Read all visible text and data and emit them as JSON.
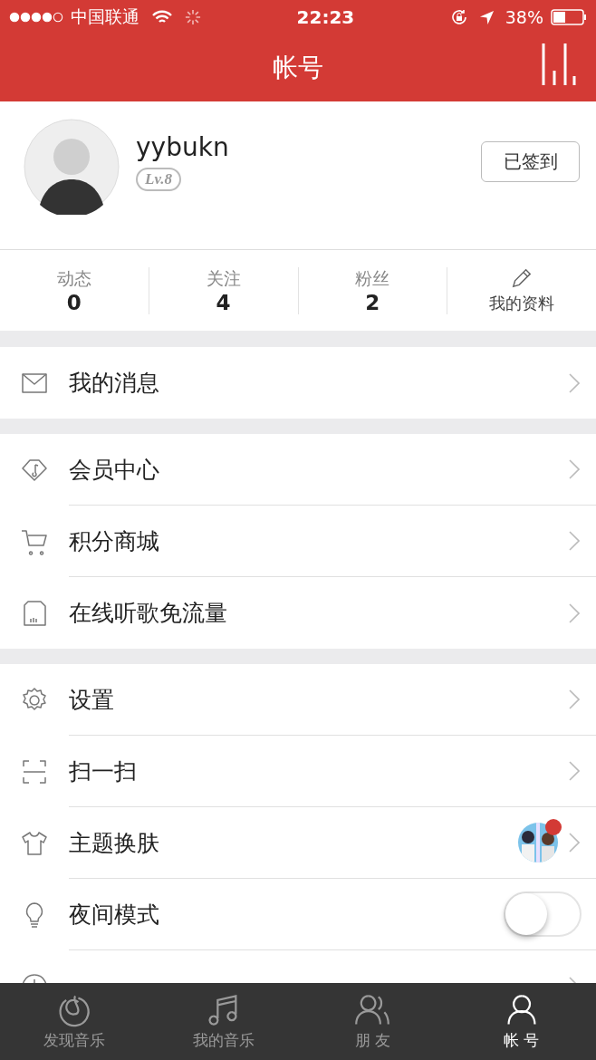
{
  "status_bar": {
    "carrier": "中国联通",
    "time": "22:23",
    "battery": "38%"
  },
  "nav": {
    "title": "帐号"
  },
  "profile": {
    "username": "yybukn",
    "level": "Lv.8",
    "checkin_button": "已签到"
  },
  "stats": [
    {
      "label": "动态",
      "value": "0"
    },
    {
      "label": "关注",
      "value": "4"
    },
    {
      "label": "粉丝",
      "value": "2"
    }
  ],
  "edit_profile": "我的资料",
  "groups": [
    [
      {
        "label": "我的消息",
        "kind": "chevron"
      }
    ],
    [
      {
        "label": "会员中心",
        "kind": "chevron"
      },
      {
        "label": "积分商城",
        "kind": "chevron"
      },
      {
        "label": "在线听歌免流量",
        "kind": "chevron"
      }
    ],
    [
      {
        "label": "设置",
        "kind": "chevron"
      },
      {
        "label": "扫一扫",
        "kind": "chevron"
      },
      {
        "label": "主题换肤",
        "kind": "theme",
        "badge": true
      },
      {
        "label": "夜间模式",
        "kind": "toggle",
        "on": false
      },
      {
        "kind": "chevron"
      }
    ]
  ],
  "tabs": [
    {
      "label": "发现音乐",
      "selected": false
    },
    {
      "label": "我的音乐",
      "selected": false
    },
    {
      "label": "朋 友",
      "selected": false
    },
    {
      "label": "帐 号",
      "selected": true
    }
  ]
}
